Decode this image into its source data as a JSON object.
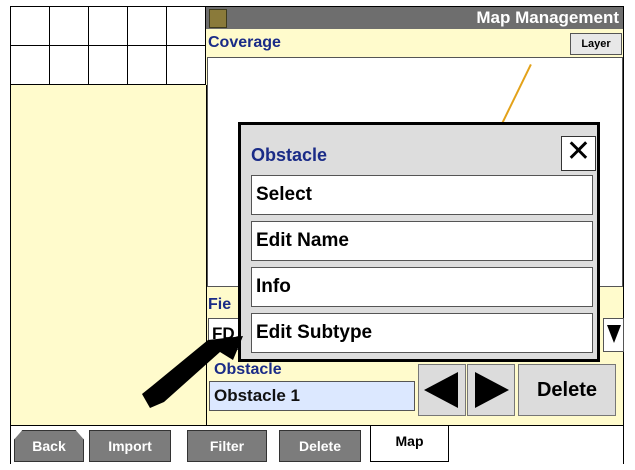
{
  "window": {
    "title": "Map Management"
  },
  "map": {
    "coverage_label": "Coverage",
    "layer_button": "Layer"
  },
  "field": {
    "label": "Fie",
    "value": "FD"
  },
  "obstacle": {
    "label": "Obstacle",
    "value": "Obstacle 1"
  },
  "actions": {
    "delete_label": "Delete"
  },
  "popup": {
    "title": "Obstacle",
    "close_symbol": "✕",
    "items": [
      "Select",
      "Edit Name",
      "Info",
      "Edit Subtype"
    ]
  },
  "tabs": [
    {
      "label": "Back"
    },
    {
      "label": "Import"
    },
    {
      "label": "Filter"
    },
    {
      "label": "Delete"
    },
    {
      "label": "Map",
      "active": true
    }
  ],
  "colors": {
    "panel_bg": "#fffbcc",
    "label_blue": "#1a2b87",
    "tab_gray": "#7c7c7c",
    "track": "#e3a21a"
  }
}
